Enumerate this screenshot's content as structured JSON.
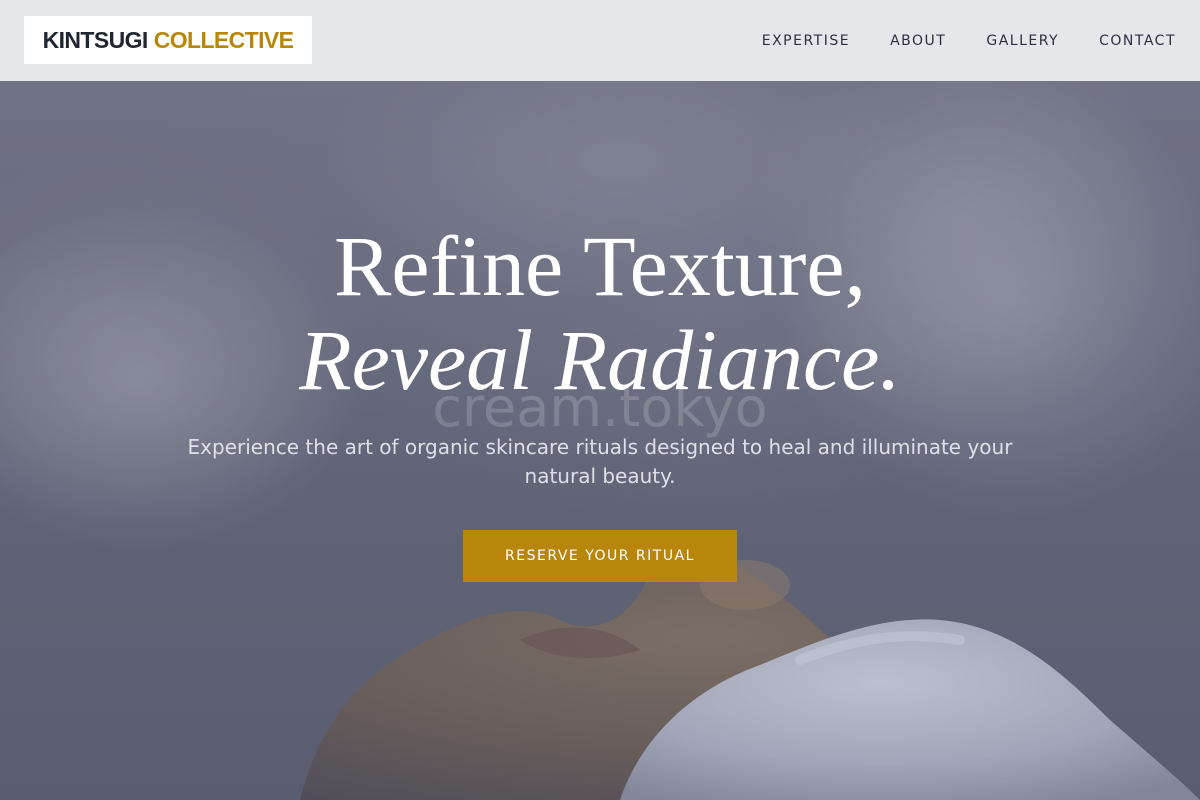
{
  "header": {
    "logo": {
      "part1": "KINTSUGI",
      "part2": "COLLECTIVE",
      "part1_color": "#1e2533",
      "part2_color": "#b8860b"
    },
    "nav": {
      "items": [
        {
          "label": "EXPERTISE"
        },
        {
          "label": "ABOUT"
        },
        {
          "label": "GALLERY"
        },
        {
          "label": "CONTACT"
        }
      ]
    }
  },
  "hero": {
    "headline_line1": "Refine Texture,",
    "headline_line2": "Reveal Radiance.",
    "watermark": "cream.tokyo",
    "subtitle": "Experience the art of organic skincare rituals designed to heal and illuminate your natural beauty.",
    "cta_label": "RESERVE YOUR RITUAL",
    "image_subject": "face-with-foam-in-steam",
    "overlay_color": "#646779"
  },
  "colors": {
    "accent": "#b8860b",
    "header_background": "#ecedf0",
    "text_dark": "#2b3040"
  }
}
